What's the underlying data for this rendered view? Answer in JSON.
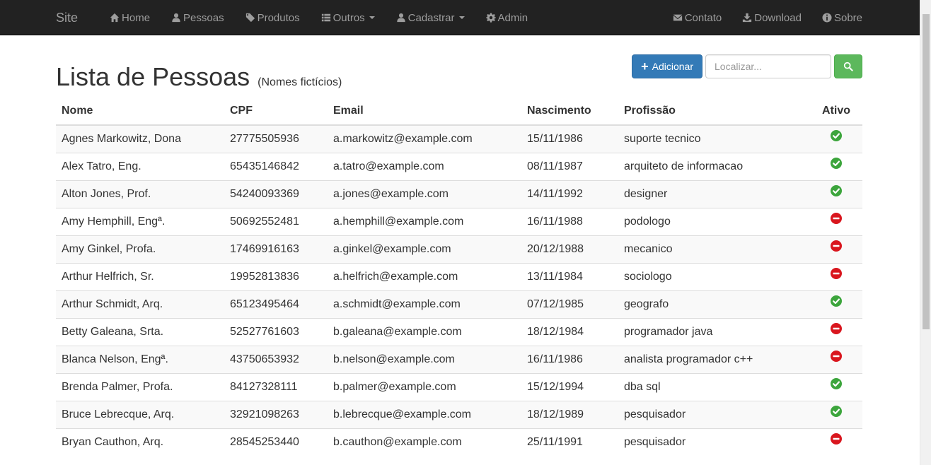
{
  "navbar": {
    "brand": "Site",
    "left_items": [
      {
        "label": "Home",
        "icon": "home-icon"
      },
      {
        "label": "Pessoas",
        "icon": "user-icon"
      },
      {
        "label": "Produtos",
        "icon": "tags-icon"
      },
      {
        "label": "Outros",
        "icon": "list-icon",
        "dropdown": true
      },
      {
        "label": "Cadastrar",
        "icon": "user-icon",
        "dropdown": true
      },
      {
        "label": "Admin",
        "icon": "gear-icon"
      }
    ],
    "right_items": [
      {
        "label": "Contato",
        "icon": "envelope-icon"
      },
      {
        "label": "Download",
        "icon": "download-icon"
      },
      {
        "label": "Sobre",
        "icon": "info-sign-icon"
      }
    ]
  },
  "header": {
    "title": "Lista de Pessoas",
    "subtitle": "(Nomes fictícios)"
  },
  "toolbar": {
    "add_label": "Adicionar",
    "search_placeholder": "Localizar..."
  },
  "table": {
    "columns": [
      "Nome",
      "CPF",
      "Email",
      "Nascimento",
      "Profissão",
      "Ativo"
    ],
    "rows": [
      {
        "nome": "Agnes Markowitz, Dona",
        "cpf": "27775505936",
        "email": "a.markowitz@example.com",
        "nascimento": "15/11/1986",
        "profissao": "suporte tecnico",
        "ativo": true
      },
      {
        "nome": "Alex Tatro, Eng.",
        "cpf": "65435146842",
        "email": "a.tatro@example.com",
        "nascimento": "08/11/1987",
        "profissao": "arquiteto de informacao",
        "ativo": true
      },
      {
        "nome": "Alton Jones, Prof.",
        "cpf": "54240093369",
        "email": "a.jones@example.com",
        "nascimento": "14/11/1992",
        "profissao": "designer",
        "ativo": true
      },
      {
        "nome": "Amy Hemphill, Engª.",
        "cpf": "50692552481",
        "email": "a.hemphill@example.com",
        "nascimento": "16/11/1988",
        "profissao": "podologo",
        "ativo": false
      },
      {
        "nome": "Amy Ginkel, Profa.",
        "cpf": "17469916163",
        "email": "a.ginkel@example.com",
        "nascimento": "20/12/1988",
        "profissao": "mecanico",
        "ativo": false
      },
      {
        "nome": "Arthur Helfrich, Sr.",
        "cpf": "19952813836",
        "email": "a.helfrich@example.com",
        "nascimento": "13/11/1984",
        "profissao": "sociologo",
        "ativo": false
      },
      {
        "nome": "Arthur Schmidt, Arq.",
        "cpf": "65123495464",
        "email": "a.schmidt@example.com",
        "nascimento": "07/12/1985",
        "profissao": "geografo",
        "ativo": true
      },
      {
        "nome": "Betty Galeana, Srta.",
        "cpf": "52527761603",
        "email": "b.galeana@example.com",
        "nascimento": "18/12/1984",
        "profissao": "programador java",
        "ativo": false
      },
      {
        "nome": "Blanca Nelson, Engª.",
        "cpf": "43750653932",
        "email": "b.nelson@example.com",
        "nascimento": "16/11/1986",
        "profissao": "analista programador c++",
        "ativo": false
      },
      {
        "nome": "Brenda Palmer, Profa.",
        "cpf": "84127328111",
        "email": "b.palmer@example.com",
        "nascimento": "15/12/1994",
        "profissao": "dba sql",
        "ativo": true
      },
      {
        "nome": "Bruce Lebrecque, Arq.",
        "cpf": "32921098263",
        "email": "b.lebrecque@example.com",
        "nascimento": "18/12/1989",
        "profissao": "pesquisador",
        "ativo": true
      },
      {
        "nome": "Bryan Cauthon, Arq.",
        "cpf": "28545253440",
        "email": "b.cauthon@example.com",
        "nascimento": "25/11/1991",
        "profissao": "pesquisador",
        "ativo": false
      }
    ]
  }
}
